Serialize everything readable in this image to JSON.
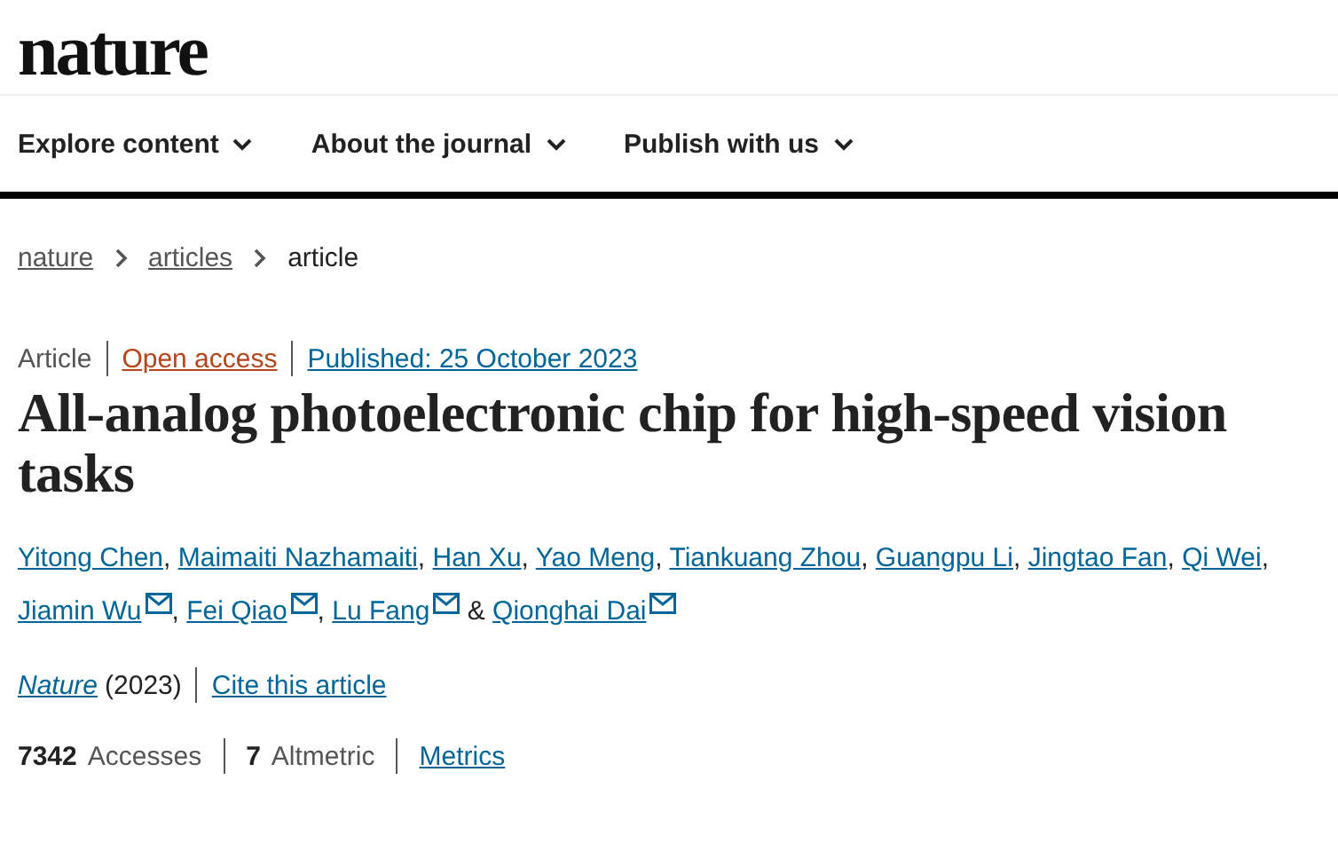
{
  "logo": "nature",
  "nav": [
    {
      "label": "Explore content"
    },
    {
      "label": "About the journal"
    },
    {
      "label": "Publish with us"
    }
  ],
  "breadcrumb": [
    {
      "label": "nature",
      "link": true
    },
    {
      "label": "articles",
      "link": true
    },
    {
      "label": "article",
      "link": false
    }
  ],
  "meta": {
    "type": "Article",
    "access": "Open access",
    "published": "Published: 25 October 2023"
  },
  "title": "All-analog photoelectronic chip for high-speed vision tasks",
  "authors": [
    {
      "name": "Yitong Chen",
      "email": false,
      "after": ","
    },
    {
      "name": "Maimaiti Nazhamaiti",
      "email": false,
      "after": ","
    },
    {
      "name": "Han Xu",
      "email": false,
      "after": ","
    },
    {
      "name": "Yao Meng",
      "email": false,
      "after": ","
    },
    {
      "name": "Tiankuang Zhou",
      "email": false,
      "after": ","
    },
    {
      "name": "Guangpu Li",
      "email": false,
      "after": ","
    },
    {
      "name": "Jingtao Fan",
      "email": false,
      "after": ","
    },
    {
      "name": "Qi Wei",
      "email": false,
      "after": ","
    },
    {
      "name": "Jiamin Wu",
      "email": true,
      "after": ","
    },
    {
      "name": "Fei Qiao",
      "email": true,
      "after": ","
    },
    {
      "name": "Lu Fang",
      "email": true,
      "after": "&"
    },
    {
      "name": "Qionghai Dai",
      "email": true
    }
  ],
  "citation": {
    "journal": "Nature",
    "year": "(2023)",
    "cite": "Cite this article"
  },
  "metrics": [
    {
      "kind": "stat",
      "count": "7342",
      "label": "Accesses"
    },
    {
      "kind": "stat",
      "count": "7",
      "label": "Altmetric"
    },
    {
      "kind": "link",
      "label": "Metrics"
    }
  ]
}
